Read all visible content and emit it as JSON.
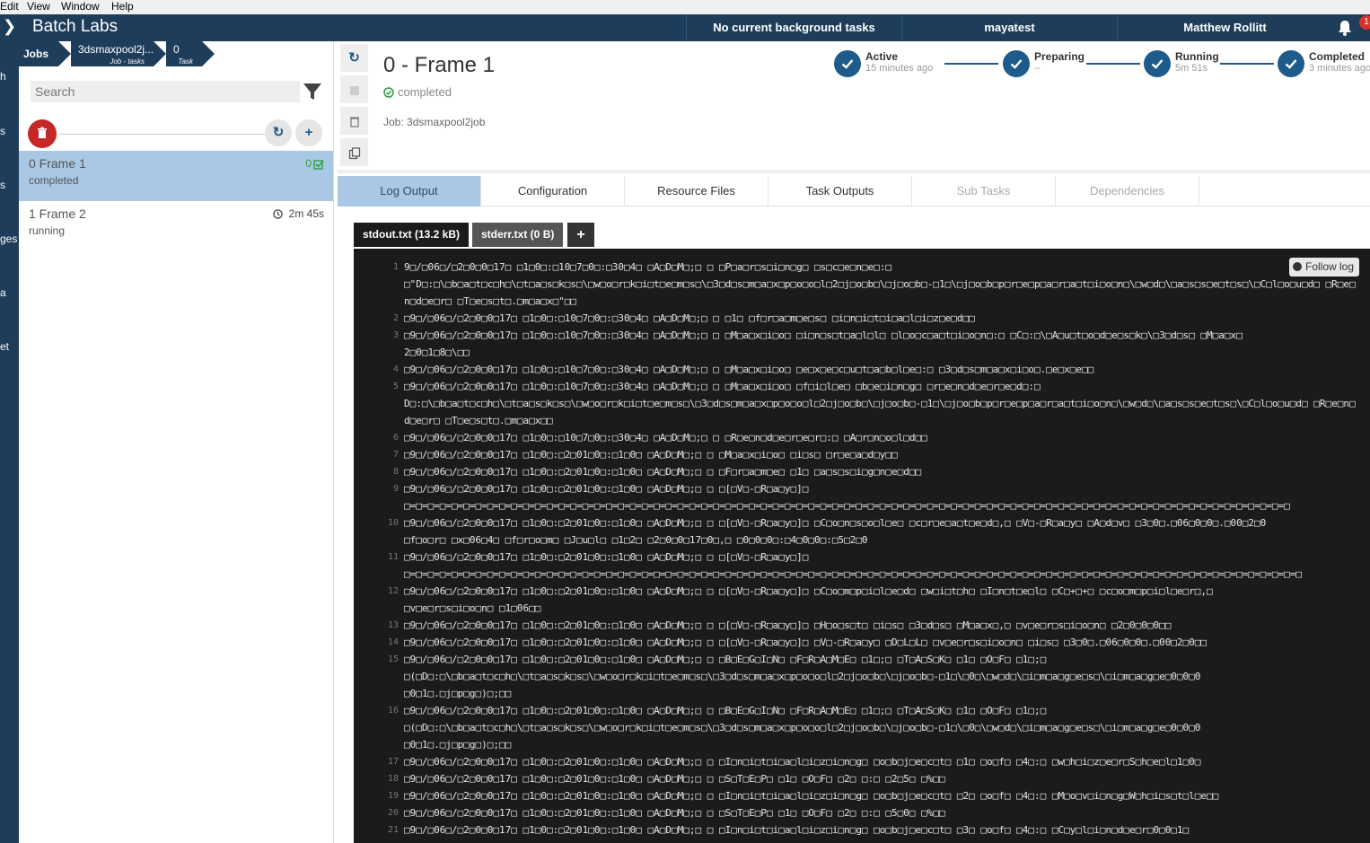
{
  "menu": {
    "items": [
      "Edit",
      "View",
      "Window",
      "Help"
    ]
  },
  "topbar": {
    "title": "Batch Labs",
    "background_tasks": "No current background tasks",
    "account": "mayatest",
    "user": "Matthew Rollitt",
    "notification_count": "1"
  },
  "leftstrip": {
    "labels": [
      "h",
      "s",
      "s",
      "ges",
      "a",
      "et"
    ]
  },
  "breadcrumb": [
    {
      "label": "Jobs",
      "sub": ""
    },
    {
      "label": "3dsmaxpool2j...",
      "sub": "Job - tasks"
    },
    {
      "label": "0",
      "sub": "Task"
    }
  ],
  "search": {
    "placeholder": "Search"
  },
  "tasks": [
    {
      "name": "0 Frame 1",
      "state": "completed",
      "right": "0"
    },
    {
      "name": "1 Frame 2",
      "state": "running",
      "right": "2m 45s"
    }
  ],
  "detail": {
    "title": "0 - Frame 1",
    "status": "completed",
    "job": "Job: 3dsmaxpool2job"
  },
  "timeline": [
    {
      "label": "Active",
      "sub": "15 minutes ago"
    },
    {
      "label": "Preparing",
      "sub": "–"
    },
    {
      "label": "Running",
      "sub": "5m 51s"
    },
    {
      "label": "Completed",
      "sub": "3 minutes ago"
    }
  ],
  "tabs": [
    "Log Output",
    "Configuration",
    "Resource Files",
    "Task Outputs",
    "Sub Tasks",
    "Dependencies"
  ],
  "file_tabs": [
    "stdout.txt (13.2 kB)",
    "stderr.txt (0 B)",
    "+"
  ],
  "follow_log": "Follow log",
  "log": [
    {
      "n": "1",
      "t": "9□/□06□/□2□0□0□17□ □1□0□:□10□7□0□:□30□4□ □A□D□M□;□ □ □P□a□r□s□i□n□g□ □s□c□e□n□e□:□\n□\"D□:□\\□b□a□t□c□h□\\□t□a□s□k□s□\\□w□o□r□k□i□t□e□m□s□\\□3□d□s□m□a□x□p□o□o□l□2□j□o□b□\\□j□o□b□-□1□\\□j□o□b□p□r□e□p□a□r□a□t□i□o□n□\\□w□d□\\□a□s□s□e□t□s□\\□C□l□o□u□d□ □R□e□n□d□e□r□ □T□e□s□t□.□m□a□x□\"□□"
    },
    {
      "n": "2",
      "t": "□9□/□06□/□2□0□0□17□ □1□0□:□10□7□0□:□30□4□ □A□D□M□;□ □ □1□ □f□r□a□m□e□s□ □i□n□i□t□i□a□l□i□z□e□d□□"
    },
    {
      "n": "3",
      "t": "□9□/□06□/□2□0□0□17□ □1□0□:□10□7□0□:□30□4□ □A□D□M□;□ □ □M□a□x□i□o□ □i□n□s□t□a□l□l□ □l□o□c□a□t□i□o□n□:□ □C□:□\\□A□u□t□o□d□e□s□k□\\□3□d□s□ □M□a□x□\n2□0□1□8□\\□□"
    },
    {
      "n": "4",
      "t": "□9□/□06□/□2□0□0□17□ □1□0□:□10□7□0□:□30□4□ □A□D□M□;□ □ □M□a□x□i□o□ □e□x□e□c□u□t□a□b□l□e□:□ □3□d□s□m□a□x□i□o□.□e□x□e□□"
    },
    {
      "n": "5",
      "t": "□9□/□06□/□2□0□0□17□ □1□0□:□10□7□0□:□30□4□ □A□D□M□;□ □ □M□a□x□i□o□ □f□i□l□e□ □b□e□i□n□g□ □r□e□n□d□e□r□e□d□:□\nD□:□\\□b□a□t□c□h□\\□t□a□s□k□s□\\□w□o□r□k□i□t□e□m□s□\\□3□d□s□m□a□x□p□o□o□l□2□j□o□b□\\□j□o□b□-□1□\\□j□o□b□p□r□e□p□a□r□a□t□i□o□n□\\□w□d□\\□a□s□s□e□t□s□\\□C□l□o□u□d□ □R□e□n□d□e□r□ □T□e□s□t□.□m□a□x□□"
    },
    {
      "n": "6",
      "t": "□9□/□06□/□2□0□0□17□ □1□0□:□10□7□0□:□30□4□ □A□D□M□;□ □ □R□e□n□d□e□r□e□r□:□ □A□r□n□o□l□d□□"
    },
    {
      "n": "7",
      "t": "□9□/□06□/□2□0□0□17□ □1□0□:□2□01□0□:□1□0□ □A□D□M□;□ □ □M□a□x□i□o□ □i□s□ □r□e□a□d□y□□"
    },
    {
      "n": "8",
      "t": "□9□/□06□/□2□0□0□17□ □1□0□:□2□01□0□:□1□0□ □A□D□M□;□ □ □F□r□a□m□e□ □1□ □a□s□s□i□g□n□e□d□□"
    },
    {
      "n": "9",
      "t": "□9□/□06□/□2□0□0□17□ □1□0□:□2□01□0□:□1□0□ □A□D□M□;□ □ □[□V□-□R□a□y□]□\n□=□=□=□=□=□=□=□=□=□=□=□=□=□=□=□=□=□=□=□=□=□=□=□=□=□=□=□=□=□=□=□=□=□=□=□=□=□=□=□=□=□=□=□=□=□=□=□=□=□=□=□=□=□=□=□=□=□=□=□=□=□=□=□=□=□=□=□=□=□=□=□=□=□=□"
    },
    {
      "n": "10",
      "t": "□9□/□06□/□2□0□0□17□ □1□0□:□2□01□0□:□1□0□ □A□D□M□;□ □ □[□V□-□R□a□y□]□ □C□o□n□s□o□l□e□ □c□r□e□a□t□e□d□,□ □V□-□R□a□y□ □A□d□v□ □3□0□.□06□0□0□.□00□2□0\n□f□o□r□ □x□06□4□ □f□r□o□m□ □J□u□l□ □1□2□ □2□0□0□17□0□,□ □0□0□0□:□4□0□0□:□5□2□0"
    },
    {
      "n": "11",
      "t": "□9□/□06□/□2□0□0□17□ □1□0□:□2□01□0□:□1□0□ □A□D□M□;□ □ □[□V□-□R□a□y□]□\n□=□=□=□=□=□=□=□=□=□=□=□=□=□=□=□=□=□=□=□=□=□=□=□=□=□=□=□=□=□=□=□=□=□=□=□=□=□=□=□=□=□=□=□=□=□=□=□=□=□=□=□=□=□=□=□=□=□=□=□=□=□=□=□=□=□=□=□=□=□=□=□=□=□=□=□"
    },
    {
      "n": "12",
      "t": "□9□/□06□/□2□0□0□17□ □1□0□:□2□01□0□:□1□0□ □A□D□M□;□ □ □[□V□-□R□a□y□]□ □C□o□m□p□i□l□e□d□ □w□i□t□h□ □I□n□t□e□l□ □C□+□+□ □c□o□m□p□i□l□e□r□,□\n□v□e□r□s□i□o□n□ □1□06□□"
    },
    {
      "n": "13",
      "t": "□9□/□06□/□2□0□0□17□ □1□0□:□2□01□0□:□1□0□ □A□D□M□;□ □ □[□V□-□R□a□y□]□ □H□o□s□t□ □i□s□ □3□d□s□ □M□a□x□,□ □v□e□r□s□i□o□n□ □2□0□0□0□□"
    },
    {
      "n": "14",
      "t": "□9□/□06□/□2□0□0□17□ □1□0□:□2□01□0□:□1□0□ □A□D□M□;□ □ □[□V□-□R□a□y□]□ □V□-□R□a□y□ □D□L□L□ □v□e□r□s□i□o□n□ □i□s□ □3□0□.□06□0□0□.□00□2□0□□"
    },
    {
      "n": "15",
      "t": "□9□/□06□/□2□0□0□17□ □1□0□:□2□01□0□:□1□0□ □A□D□M□;□ □ □B□E□G□I□N□ □F□R□A□M□E□ □1□;□ □T□A□S□K□ □1□ □O□F□ □1□;□\n□(□D□:□\\□b□a□t□c□h□\\□t□a□s□k□s□\\□w□o□r□k□i□t□e□m□s□\\□3□d□s□m□a□x□p□o□o□l□2□j□o□b□\\□j□o□b□-□1□\\□0□\\□w□d□\\□i□m□a□g□e□s□\\□i□m□a□g□e□0□0□0\n□0□1□.□j□p□g□)□;□□"
    },
    {
      "n": "16",
      "t": "□9□/□06□/□2□0□0□17□ □1□0□:□2□01□0□:□1□0□ □A□D□M□;□ □ □B□E□G□I□N□ □F□R□A□M□E□ □1□;□ □T□A□S□K□ □1□ □O□F□ □1□;□\n□(□D□:□\\□b□a□t□c□h□\\□t□a□s□k□s□\\□w□o□r□k□i□t□e□m□s□\\□3□d□s□m□a□x□p□o□o□l□2□j□o□b□\\□j□o□b□-□1□\\□0□\\□w□d□\\□i□m□a□g□e□s□\\□i□m□a□g□e□0□0□0\n□0□1□.□j□p□g□)□;□□"
    },
    {
      "n": "17",
      "t": "□9□/□06□/□2□0□0□17□ □1□0□:□2□01□0□:□1□0□ □A□D□M□;□ □ □I□n□i□t□i□a□l□i□z□i□n□g□ □o□b□j□e□c□t□ □1□ □o□f□ □4□:□ □w□h□i□z□e□r□S□h□e□l□1□0□"
    },
    {
      "n": "18",
      "t": "□9□/□06□/□2□0□0□17□ □1□0□:□2□01□0□:□1□0□ □A□D□M□;□ □ □S□T□E□P□ □1□ □O□F□ □2□ □:□ □2□5□ □%□□"
    },
    {
      "n": "19",
      "t": "□9□/□06□/□2□0□0□17□ □1□0□:□2□01□0□:□1□0□ □A□D□M□;□ □ □I□n□i□t□i□a□l□i□z□i□n□g□ □o□b□j□e□c□t□ □2□ □o□f□ □4□:□ □M□o□v□i□n□g□W□h□i□s□t□l□e□□"
    },
    {
      "n": "20",
      "t": "□9□/□06□/□2□0□0□17□ □1□0□:□2□01□0□:□1□0□ □A□D□M□;□ □ □S□T□E□P□ □1□ □O□F□ □2□ □:□ □5□0□ □%□□"
    },
    {
      "n": "21",
      "t": "□9□/□06□/□2□0□0□17□ □1□0□:□2□01□0□:□1□0□ □A□D□M□;□ □ □I□n□i□t□i□a□l□i□z□i□n□g□ □o□b□j□e□c□t□ □3□ □o□f□ □4□:□ □C□y□l□i□n□d□e□r□0□0□1□"
    }
  ],
  "colors": {
    "navy": "#1e3d5a",
    "accent": "#1e5a8a",
    "selected": "#a9c8e6",
    "success": "#2e9e44",
    "danger": "#c62828",
    "log_bg": "#1b1b1b"
  }
}
